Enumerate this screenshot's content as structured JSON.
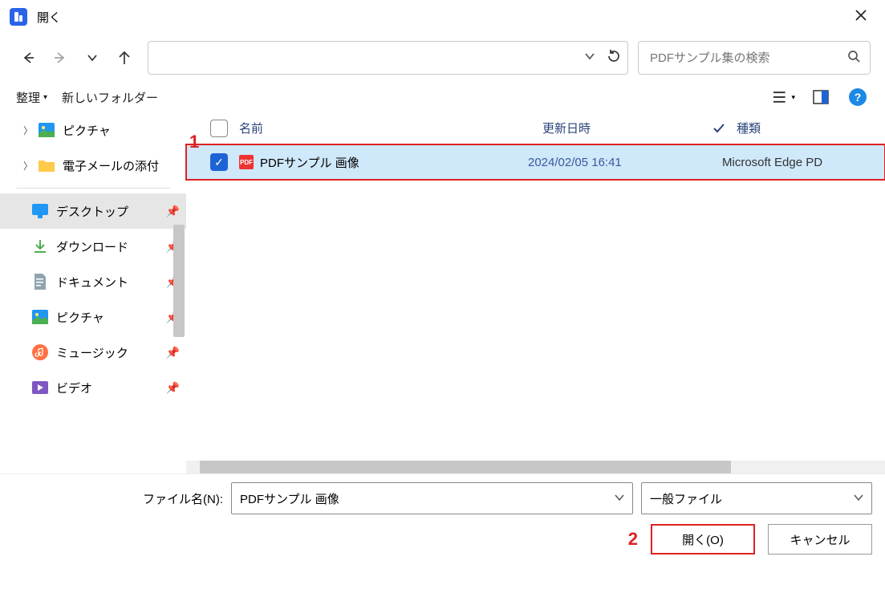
{
  "title": "開く",
  "search_placeholder": "PDFサンプル集の検索",
  "toolbar": {
    "organize": "整理",
    "new_folder": "新しいフォルダー"
  },
  "tree": [
    {
      "label": "ピクチャ",
      "chevron": true
    },
    {
      "label": "電子メールの添付",
      "chevron": true
    }
  ],
  "quick": [
    {
      "label": "デスクトップ",
      "active": true,
      "icon": "desktop"
    },
    {
      "label": "ダウンロード",
      "icon": "download"
    },
    {
      "label": "ドキュメント",
      "icon": "document"
    },
    {
      "label": "ピクチャ",
      "icon": "picture"
    },
    {
      "label": "ミュージック",
      "icon": "music"
    },
    {
      "label": "ビデオ",
      "icon": "video"
    }
  ],
  "columns": {
    "name": "名前",
    "date": "更新日時",
    "type": "種類"
  },
  "file": {
    "name": "PDFサンプル 画像",
    "date": "2024/02/05 16:41",
    "type": "Microsoft Edge PD"
  },
  "footer": {
    "filename_label": "ファイル名(N):",
    "filename_value": "PDFサンプル 画像",
    "filetype_value": "一般ファイル",
    "open_btn": "開く(O)",
    "cancel_btn": "キャンセル"
  },
  "annotations": {
    "one": "1",
    "two": "2"
  }
}
